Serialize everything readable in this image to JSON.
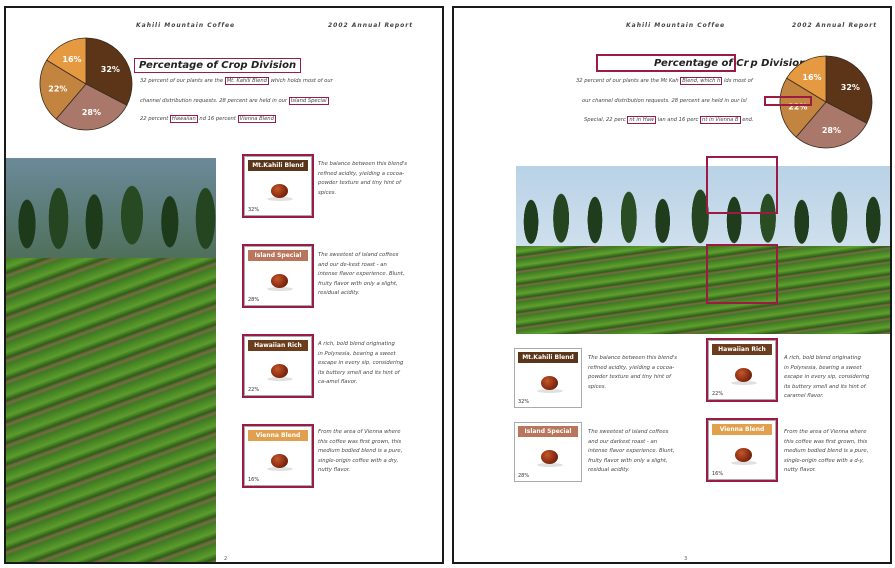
{
  "header": {
    "company": "Kahili Mountain Coffee",
    "report": "2002 Annual Report"
  },
  "colors": {
    "highlight": "#9b1b45",
    "mt_kahili": "#5a3519",
    "island_special": "#b9765c",
    "hawaiian_rich": "#6b3d1c",
    "vienna_blend": "#e0a04e"
  },
  "pie": {
    "slices": [
      {
        "label": "32%",
        "value": 32,
        "color": "#5c3518"
      },
      {
        "label": "28%",
        "value": 28,
        "color": "#a9786a"
      },
      {
        "label": "22%",
        "value": 22,
        "color": "#c2843f"
      },
      {
        "label": "16%",
        "value": 16,
        "color": "#e59a42"
      }
    ]
  },
  "section": {
    "title": "Percentage of Crop Division",
    "title_right": "Percentage of Cr p Division"
  },
  "left_text": {
    "line1_a": "32 percent of our plants are the",
    "line1_hl": "Mt. Kahili Blend",
    "line1_b": "which holds most of our",
    "line2_a": "channel distribution requests. 28 percent are held in our",
    "line2_hl": "Island Special",
    "line3_a": "22 percent",
    "line3_hl1": "Hawaiian",
    "line3_b": "nd 16 percent",
    "line3_hl2": "Vienna Blend"
  },
  "right_text": {
    "line1_a": "32 percent of our plants are the Mt Kah",
    "line1_hl": "Blend, which h",
    "line1_b": "lds most of",
    "line2_a": "our channel distribution requests. 28 percent are held in our Isl",
    "line3_a": "Special, 22 perc",
    "line3_hl1": "nt in Haw",
    "line3_b": "ian and 16 perc",
    "line3_hl2": "nt in Vienna B",
    "line3_c": "end."
  },
  "products": [
    {
      "name": "Mt.Kahili Blend",
      "pct": "32%",
      "color": "#5a3519",
      "desc": [
        "The balance between this blend's",
        "refined acidity, yielding a cocoa-",
        "powder texture and tiny hint of",
        "spices."
      ]
    },
    {
      "name": "Island Special",
      "pct": "28%",
      "color": "#b9765c",
      "desc": [
        "The sweetest of island coffees",
        "and our darkest roast - an",
        "intense flavor experience. Blunt,",
        "fruity flavor with only a slight,",
        "residual acidity."
      ]
    },
    {
      "name": "Hawaiian Rich",
      "pct": "22%",
      "color": "#6b3d1c",
      "desc": [
        "A rich, bold blend originating",
        "in Polynesia, bearing a sweet",
        "escape in every sip, considering",
        "its buttery smell and its hint of",
        "caramel flavor."
      ]
    },
    {
      "name": "Vienna Blend",
      "pct": "16%",
      "color": "#e0a04e",
      "desc": [
        "From the area of Vienna where",
        "this coffee was first grown, this",
        "medium bodied blend is a pure,",
        "single-origin coffee with a dry,",
        "nutty flavor."
      ]
    }
  ],
  "left_desc": [
    [
      "The balance between this blend's",
      "refined acidity, yielding a cocoa-",
      "powder texture and tiny hint of",
      "spices."
    ],
    [
      "The sweetest of island coffees",
      "and our de-kest roast - an",
      "intense flavor experience. Blunt,",
      "fruity flavor with only a slight,",
      "residual acidity."
    ],
    [
      "A rich, bold blend originating",
      "in Polynesia, bearing a sweet",
      "escape in every sip, considering",
      "its buttery smell and its hint of",
      "ca-amel flavor."
    ],
    [
      "From the area of Vienna where",
      "this coffee was first grown, this",
      "medium bodied blend is a pure,",
      "single-origin coffee with a dry,",
      "nutty flavor."
    ]
  ],
  "right_desc": [
    [
      "The balance between this blend's",
      "refined acidity, yielding a cocoa-",
      "powder texture and tiny hint of",
      "spices."
    ],
    [
      "The sweetest of island coffees",
      "and our darkest roast - an",
      "intense flavor experience. Blunt,",
      "fruity flavor with only a slight,",
      "residual acidity."
    ],
    [
      "A rich, bold blend originating",
      "in Polynesia, bearing a sweet",
      "escape in every sip, considering",
      "its buttery smell and its hint of",
      "caramel flavor."
    ],
    [
      "From the area of Vienna where",
      "this coffee was first grown, this",
      "medium bodied blend is a pure,",
      "single-origin coffee with a d-y,",
      "nutty flavor."
    ]
  ],
  "page_numbers": {
    "left": "2",
    "right": "3"
  }
}
